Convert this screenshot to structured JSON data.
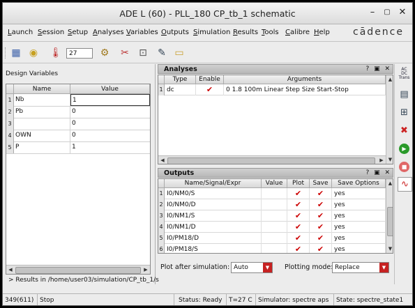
{
  "window": {
    "title": "ADE L (60) - PLL_180 CP_tb_1 schematic"
  },
  "menu": [
    "Launch",
    "Session",
    "Setup",
    "Analyses",
    "Variables",
    "Outputs",
    "Simulation",
    "Results",
    "Tools",
    "Calibre",
    "Help"
  ],
  "brand": "cādence",
  "toolbar": {
    "temperature": "27",
    "icons": [
      "save-icon",
      "load-state-icon",
      "temperature-icon",
      "settings-icon",
      "netlist-icon",
      "lock-icon",
      "edit-icon",
      "open-folder-icon"
    ]
  },
  "design_variables": {
    "label": "Design Variables",
    "headers": [
      "Name",
      "Value"
    ],
    "rows": [
      {
        "num": "1",
        "name": "Nb",
        "value": "1"
      },
      {
        "num": "2",
        "name": "Pb",
        "value": "0"
      },
      {
        "num": "3",
        "name": "",
        "value": "0"
      },
      {
        "num": "4",
        "name": "OWN",
        "value": "0"
      },
      {
        "num": "5",
        "name": "P",
        "value": "1"
      }
    ]
  },
  "analyses": {
    "title": "Analyses",
    "headers": [
      "Type",
      "Enable",
      "Arguments"
    ],
    "rows": [
      {
        "num": "1",
        "type": "dc",
        "enabled": true,
        "args": "0 1.8 100m Linear Step Size Start-Stop"
      }
    ]
  },
  "outputs": {
    "title": "Outputs",
    "headers": [
      "Name/Signal/Expr",
      "Value",
      "Plot",
      "Save",
      "Save Options"
    ],
    "rows": [
      {
        "num": "1",
        "name": "I0/NM0/S",
        "value": "",
        "plot": true,
        "save": true,
        "opt": "yes"
      },
      {
        "num": "2",
        "name": "I0/NM0/D",
        "value": "",
        "plot": true,
        "save": true,
        "opt": "yes"
      },
      {
        "num": "3",
        "name": "I0/NM1/S",
        "value": "",
        "plot": true,
        "save": true,
        "opt": "yes"
      },
      {
        "num": "4",
        "name": "I0/NM1/D",
        "value": "",
        "plot": true,
        "save": true,
        "opt": "yes"
      },
      {
        "num": "5",
        "name": "I0/PM18/D",
        "value": "",
        "plot": true,
        "save": true,
        "opt": "yes"
      },
      {
        "num": "6",
        "name": "I0/PM18/S",
        "value": "",
        "plot": true,
        "save": true,
        "opt": "yes"
      }
    ]
  },
  "options": {
    "plot_after_label": "Plot after simulation:",
    "plot_after_value": "Auto",
    "plotting_mode_label": "Plotting mode:",
    "plotting_mode_value": "Replace"
  },
  "results_path": "> Results in /home/user03/simulation/CP_tb_1/s",
  "status": {
    "count": "349(611)",
    "action": "Stop",
    "state": "Status: Ready",
    "temp": "T=27 C",
    "simulator": "Simulator: spectre aps",
    "session_state": "State: spectre_state1"
  },
  "right_tools": [
    "analysis-ac-dc-tran-icon",
    "design-variables-icon",
    "outputs-setup-icon",
    "delete-icon",
    "run-icon",
    "stop-icon",
    "plot-icon"
  ]
}
